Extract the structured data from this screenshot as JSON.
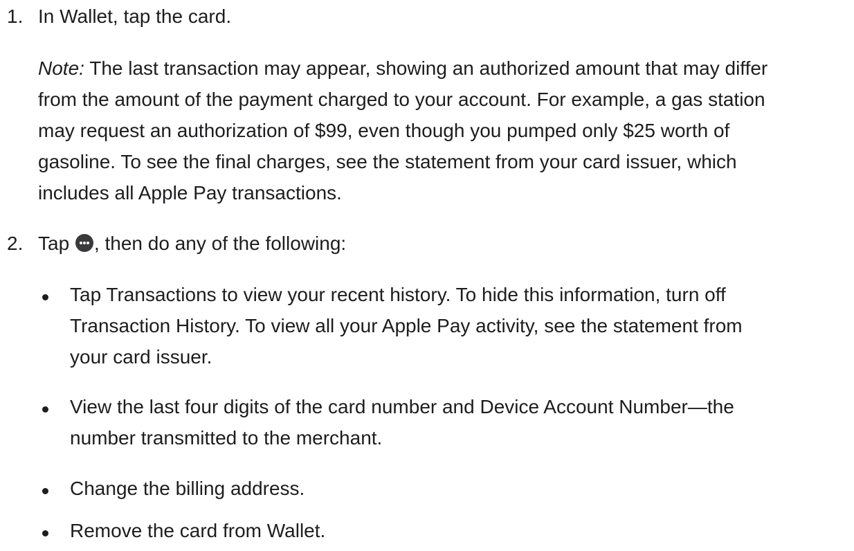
{
  "steps": [
    {
      "number": "1.",
      "text": "In Wallet, tap the card.",
      "note": {
        "label": "Note:",
        "lines": [
          " The last transaction may appear, showing an authorized amount that may differ",
          "from the amount of the payment charged to your account. For example, a gas station",
          "may request an authorization of $99, even though you pumped only $25 worth of",
          "gasoline. To see the final charges, see the statement from your card issuer, which",
          "includes all Apple Pay transactions."
        ]
      }
    },
    {
      "number": "2.",
      "text_before_icon": "Tap ",
      "icon": "more-icon",
      "text_after_icon": ", then do any of the following:",
      "bullets": [
        {
          "lines": [
            "Tap Transactions to view your recent history. To hide this information, turn off",
            "Transaction History. To view all your Apple Pay activity, see the statement from",
            "your card issuer."
          ]
        },
        {
          "lines": [
            "View the last four digits of the card number and Device Account Number—the",
            "number transmitted to the merchant."
          ]
        },
        {
          "lines": [
            "Change the billing address."
          ]
        },
        {
          "lines": [
            "Remove the card from Wallet."
          ]
        }
      ]
    }
  ],
  "colors": {
    "text": "#1d1d1f",
    "icon_fill": "#3a3a3c",
    "background": "#ffffff"
  }
}
